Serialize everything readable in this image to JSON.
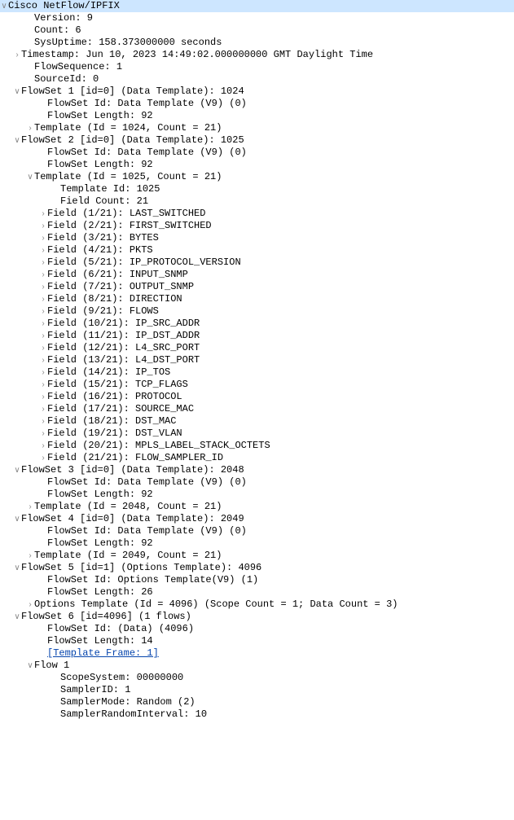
{
  "root": {
    "label": "Cisco NetFlow/IPFIX"
  },
  "hdr": {
    "version": "Version: 9",
    "count": "Count: 6",
    "sysuptime": "SysUptime: 158.373000000 seconds",
    "timestamp": "Timestamp: Jun 10, 2023 14:49:02.000000000 GMT Daylight Time",
    "flowseq": "FlowSequence: 1",
    "sourceid": "SourceId: 0"
  },
  "fs1": {
    "head": "FlowSet 1 [id=0] (Data Template): 1024",
    "id": "FlowSet Id: Data Template (V9) (0)",
    "len": "FlowSet Length: 92",
    "tmpl": "Template (Id = 1024, Count = 21)"
  },
  "fs2": {
    "head": "FlowSet 2 [id=0] (Data Template): 1025",
    "id": "FlowSet Id: Data Template (V9) (0)",
    "len": "FlowSet Length: 92",
    "tmpl": "Template (Id = 1025, Count = 21)",
    "tid": "Template Id: 1025",
    "fcount": "Field Count: 21",
    "fields": [
      "Field (1/21): LAST_SWITCHED",
      "Field (2/21): FIRST_SWITCHED",
      "Field (3/21): BYTES",
      "Field (4/21): PKTS",
      "Field (5/21): IP_PROTOCOL_VERSION",
      "Field (6/21): INPUT_SNMP",
      "Field (7/21): OUTPUT_SNMP",
      "Field (8/21): DIRECTION",
      "Field (9/21): FLOWS",
      "Field (10/21): IP_SRC_ADDR",
      "Field (11/21): IP_DST_ADDR",
      "Field (12/21): L4_SRC_PORT",
      "Field (13/21): L4_DST_PORT",
      "Field (14/21): IP_TOS",
      "Field (15/21): TCP_FLAGS",
      "Field (16/21): PROTOCOL",
      "Field (17/21): SOURCE_MAC",
      "Field (18/21): DST_MAC",
      "Field (19/21): DST_VLAN",
      "Field (20/21): MPLS_LABEL_STACK_OCTETS",
      "Field (21/21): FLOW_SAMPLER_ID"
    ]
  },
  "fs3": {
    "head": "FlowSet 3 [id=0] (Data Template): 2048",
    "id": "FlowSet Id: Data Template (V9) (0)",
    "len": "FlowSet Length: 92",
    "tmpl": "Template (Id = 2048, Count = 21)"
  },
  "fs4": {
    "head": "FlowSet 4 [id=0] (Data Template): 2049",
    "id": "FlowSet Id: Data Template (V9) (0)",
    "len": "FlowSet Length: 92",
    "tmpl": "Template (Id = 2049, Count = 21)"
  },
  "fs5": {
    "head": "FlowSet 5 [id=1] (Options Template): 4096",
    "id": "FlowSet Id: Options Template(V9) (1)",
    "len": "FlowSet Length: 26",
    "tmpl": "Options Template (Id = 4096) (Scope Count = 1; Data Count = 3)"
  },
  "fs6": {
    "head": "FlowSet 6 [id=4096] (1 flows)",
    "id": "FlowSet Id: (Data) (4096)",
    "len": "FlowSet Length: 14",
    "link": "[Template Frame: 1]",
    "flow": "Flow 1",
    "scope": "ScopeSystem: 00000000",
    "samplerid": "SamplerID: 1",
    "samplermode": "SamplerMode: Random (2)",
    "samplerinterval": "SamplerRandomInterval: 10"
  },
  "glyph": {
    "open": "∨",
    "closed": "›"
  }
}
